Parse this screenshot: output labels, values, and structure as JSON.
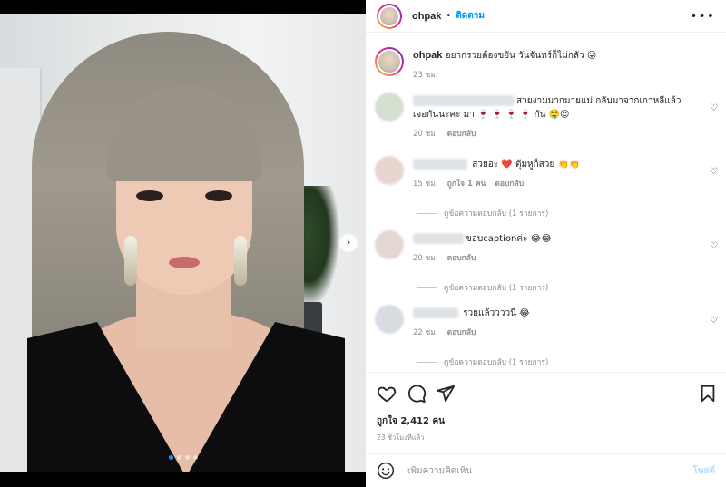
{
  "post": {
    "username": "ohpak",
    "follow_label": "ติดตาม",
    "more_label": "•••",
    "caption": {
      "username": "ohpak",
      "text": "อยากรวยต้องขยัน วันจันทร์ก็ไม่กลัว 😛",
      "time": "23 ชม."
    },
    "media": {
      "next_label": "›",
      "slide_count": 4,
      "active_slide": 1
    }
  },
  "comments": [
    {
      "text": "สวยงามมากมายแม่ กลับมาจากเกาหลีแล้ว เจอกันนะคะ มา 🍷 🍷 🍷 🍷 กัน 🤤😍",
      "time": "20 ชม.",
      "likes": "",
      "reply_label": "ตอบกลับ",
      "view_replies": ""
    },
    {
      "text": "สวยอะ ❤️ ตุ้มหูก็สวย 👏👏",
      "time": "15 ชม.",
      "likes": "ถูกใจ 1 คน",
      "reply_label": "ตอบกลับ",
      "view_replies": "ดูข้อความตอบกลับ (1 รายการ)"
    },
    {
      "text": "ขอบcaptionค่ะ 😂😂",
      "time": "20 ชม.",
      "likes": "",
      "reply_label": "ตอบกลับ",
      "view_replies": "ดูข้อความตอบกลับ (1 รายการ)"
    },
    {
      "text": "รวยแล้ววววนี่ 😂",
      "time": "22 ชม.",
      "likes": "",
      "reply_label": "ตอบกลับ",
      "view_replies": "ดูข้อความตอบกลับ (1 รายการ)"
    }
  ],
  "actions": {
    "likes": "ถูกใจ 2,412 คน",
    "time": "23 ชั่วโมงที่แล้ว"
  },
  "add_comment": {
    "placeholder": "เพิ่มความคิดเห็น",
    "post_label": "โพสต์"
  },
  "colors": {
    "accent": "#0095f6",
    "post_disabled": "#b2dffc",
    "muted": "#8e8e8e"
  },
  "icons": [
    "heart-icon",
    "comment-icon",
    "share-icon",
    "bookmark-icon",
    "emoji-icon",
    "more-icon",
    "chevron-right-icon"
  ]
}
